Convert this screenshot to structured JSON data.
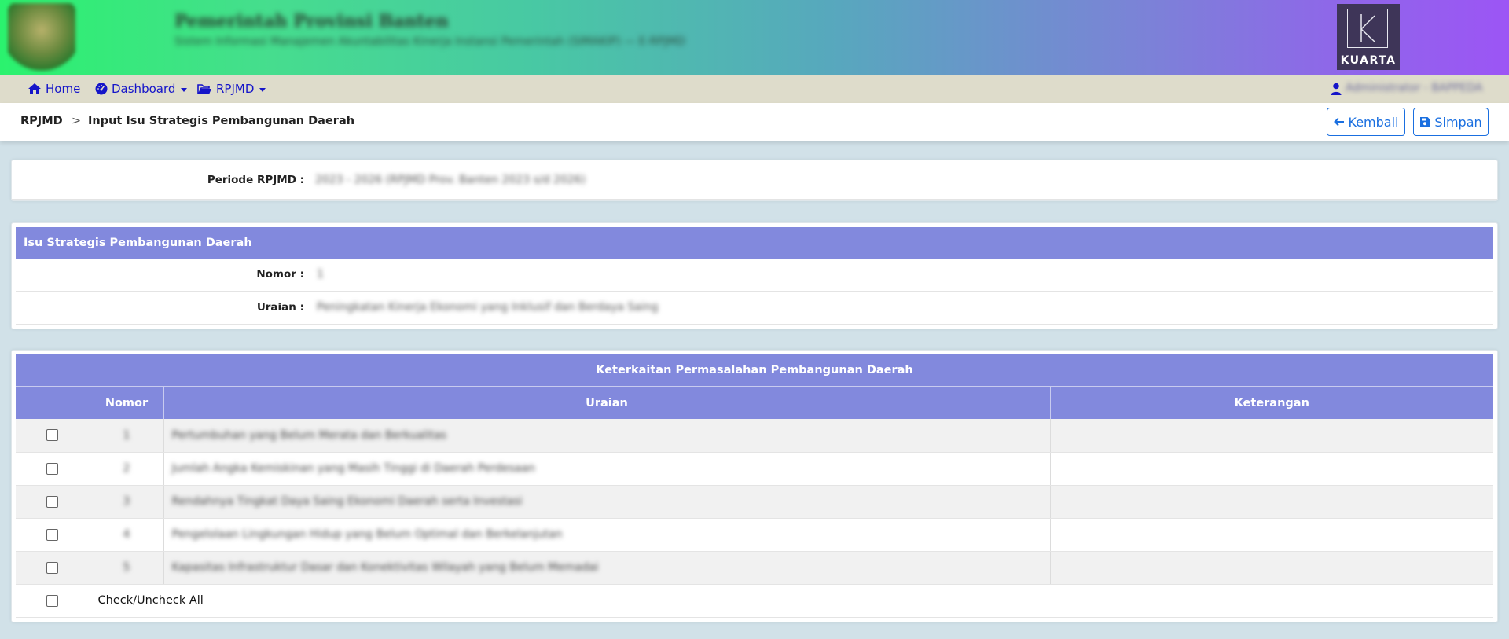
{
  "header": {
    "org_title": "Pemerintah Provinsi Banten",
    "org_subtitle": "Sistem Informasi Manajemen Akuntabilitas Kinerja Instansi Pemerintah (SIMAKIP) — E-RPJMD",
    "logo_left_icon": "government-seal-icon",
    "brand_logo_text": "KUARTA",
    "gradient_colors": [
      "#2bf26e",
      "#57a8bd",
      "#9c55f5"
    ]
  },
  "nav": {
    "home": "Home",
    "dashboard": "Dashboard",
    "rpjmd": "RPJMD",
    "user_name": "Administrator - BAPPEDA"
  },
  "breadcrumb": {
    "root": "RPJMD",
    "separator": ">",
    "current": "Input Isu Strategis Pembangunan Daerah"
  },
  "actions": {
    "back_label": "Kembali",
    "save_label": "Simpan"
  },
  "periode": {
    "label": "Periode RPJMD :",
    "value": "2023 - 2026 (RPJMD Prov. Banten 2023 s/d 2026)"
  },
  "isu": {
    "section_title": "Isu Strategis Pembangunan Daerah",
    "nomor_label": "Nomor :",
    "nomor_value": "1",
    "uraian_label": "Uraian :",
    "uraian_value": "Peningkatan Kinerja Ekonomi yang Inklusif dan Berdaya Saing"
  },
  "table": {
    "title": "Keterkaitan Permasalahan Pembangunan Daerah",
    "columns": [
      "",
      "Nomor",
      "Uraian",
      "Keterangan"
    ],
    "rows": [
      {
        "nomor": "1",
        "uraian": "Pertumbuhan yang Belum Merata dan Berkualitas",
        "keterangan": ""
      },
      {
        "nomor": "2",
        "uraian": "Jumlah Angka Kemiskinan yang Masih Tinggi di Daerah Perdesaan",
        "keterangan": ""
      },
      {
        "nomor": "3",
        "uraian": "Rendahnya Tingkat Daya Saing Ekonomi Daerah serta Investasi",
        "keterangan": ""
      },
      {
        "nomor": "4",
        "uraian": "Pengelolaan Lingkungan Hidup yang Belum Optimal dan Berkelanjutan",
        "keterangan": ""
      },
      {
        "nomor": "5",
        "uraian": "Kapasitas Infrastruktur Dasar dan Konektivitas Wilayah yang Belum Memadai",
        "keterangan": ""
      }
    ],
    "check_all_label": "Check/Uncheck All"
  }
}
